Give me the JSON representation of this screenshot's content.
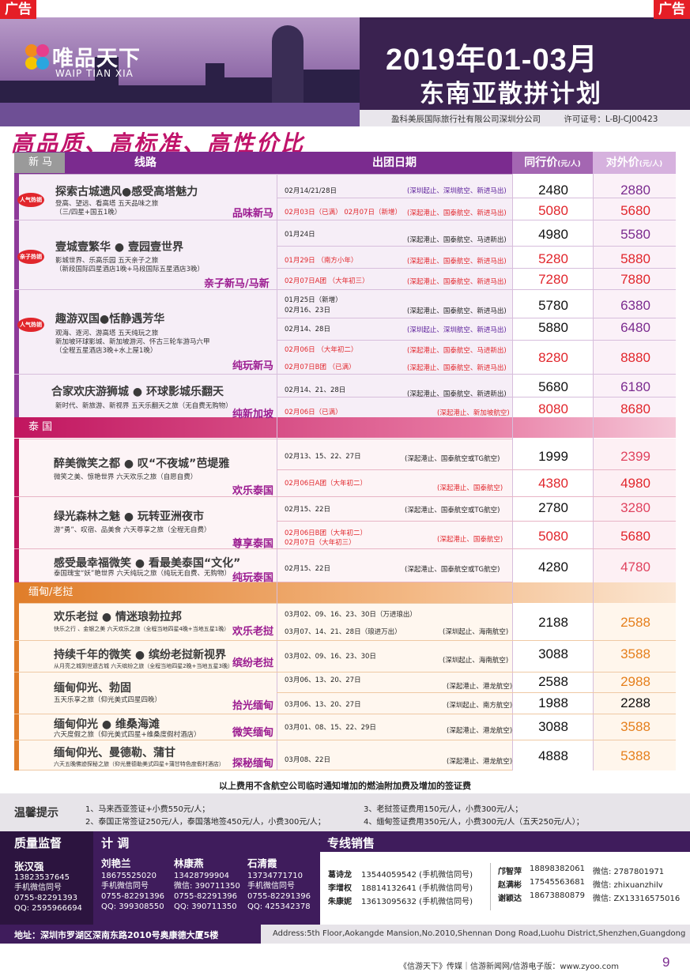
{
  "ad_label": "广告",
  "brand": {
    "cn": "唯品天下",
    "en": "WAIP TIAN XIA"
  },
  "header": {
    "title1": "2019年01-03月",
    "title2": "东南亚散拼计划",
    "company": "盈科美辰国际旅行社有限公司深圳分公司",
    "license": "许可证号：L-BJ-CJ00423"
  },
  "slogan": "高品质、高标准、高性价比",
  "table_header": {
    "route": "线路",
    "date": "出团日期",
    "peer": "同行价",
    "peer_unit": "(元/人)",
    "public": "对外价",
    "public_unit": "(元/人)"
  },
  "regions": {
    "sgmy": "新 马",
    "th": "泰 国",
    "mm": "缅甸/老挝"
  },
  "badges": {
    "hot": "人气热销",
    "family": "亲子热销"
  },
  "routes": [
    {
      "name": "探索古城遗风●感受高塔魅力",
      "desc": [
        "登高、望远、看高塔 五天品味之旅",
        "（三/四星+国五1晚）"
      ],
      "tag": "品味新马"
    },
    {
      "name": "壹城壹繁华 ● 壹园壹世界",
      "desc": [
        "影城世界、乐高乐园 五天亲子之旅",
        "（新段国际四星酒店1晚+马段国际五星酒店3晚）"
      ],
      "tag": "亲子新马/马新"
    },
    {
      "name": "趣游双国●恬静遇芳华",
      "desc": [
        "观海、逐河、游高塔 五天纯玩之旅",
        "新加坡环球影城、新加坡游河、怀古三轮车游马六甲",
        "（全程五星酒店3晚+水上屋1晚）"
      ],
      "tag": "纯玩新马"
    },
    {
      "name": "合家欢庆游狮城 ● 环球影城乐翻天",
      "desc": [
        "新时代、新旅游、新视界  五天乐翻天之旅（无自费无购物）"
      ],
      "tag": "纯新加坡"
    },
    {
      "name": "醉美微笑之都 ● 叹“不夜城”芭堤雅",
      "desc": [
        "微笑之美、惊艳世界 六天欢乐之旅（自愿自费）"
      ],
      "tag": "欢乐泰国"
    },
    {
      "name": "绿光森林之魅 ● 玩转亚洲夜市",
      "desc": [
        "游“勇”、叹宿、品美食 六天尊享之旅（全程无自费）"
      ],
      "tag": "尊享泰国"
    },
    {
      "name": "感受最幸福微笑 ● 看最美泰国“文化”",
      "desc": [
        "泰国瑰宝“妖”艳世界 六天纯玩之旅（纯玩无自费、无购物）"
      ],
      "tag": "纯玩泰国"
    },
    {
      "name": "欢乐老挝  ●  情迷琅勃拉邦",
      "desc": [
        "快乐之行 、金银之美 六天欢乐之旅（全程当地四星4晚+当地五星1晚）"
      ],
      "tag": "欢乐老挝"
    },
    {
      "name": "持续千年的微笑 ● 缤纷老挝新视界",
      "desc": [
        "从月亮之城到世遗古城 六天缤纷之旅（全程当地四星2晚+当地五星3晚）"
      ],
      "tag": "缤纷老挝"
    },
    {
      "name": "缅甸仰光、勃固",
      "desc": [
        "五天乐享之旅（仰光美式四星四晚）"
      ],
      "tag": "拾光缅甸"
    },
    {
      "name": "缅甸仰光 ● 维桑海滩",
      "desc": [
        "六天度假之旅（仰光美式四星+维桑度假村酒店）"
      ],
      "tag": "微笑缅甸"
    },
    {
      "name": "缅甸仰光、曼德勒、蒲甘",
      "desc": [
        "六天五晚佛迹探秘之旅（仰光曼德勒美式四星+蒲甘特色度假村酒店）"
      ],
      "tag": "探秘缅甸"
    }
  ],
  "departures": [
    {
      "dates": "02月14/21/28日",
      "note": "(深圳起止、深圳航空、新进马出)",
      "peer": "2480",
      "public": "2880"
    },
    {
      "dates": "02月03日（已满） 02月07日（新增）",
      "note": "(深起港止、国泰航空、新进马出)",
      "peer": "5080",
      "public": "5680"
    },
    {
      "dates": "01月24日",
      "note": "(深起港止、国泰航空、马进新出)",
      "peer": "4980",
      "public": "5580"
    },
    {
      "dates": "01月29日  （南方小年）",
      "note": "(深起港止、国泰航空、新进马出)",
      "peer": "5280",
      "public": "5880"
    },
    {
      "dates": "02月07日A团  （大年初三）",
      "note": "(深起港止、国泰航空、新进马出)",
      "peer": "7280",
      "public": "7880"
    },
    {
      "dates": "01月25日（新增）",
      "note": "",
      "peer": "",
      "public": ""
    },
    {
      "dates": "02月16、23日",
      "note": "(深起港止、国泰航空、新进马出)",
      "peer": "5780",
      "public": "6380"
    },
    {
      "dates": "02月14、28日",
      "note": "(深圳起止、深圳航空、新进马出)",
      "peer": "5880",
      "public": "6480"
    },
    {
      "dates": "02月06日    （大年初二）",
      "note": "(深起港止、国泰航空、马进新出)",
      "peer": "",
      "public": ""
    },
    {
      "dates": "02月07日B团  （已满）",
      "note": "(深起港止、国泰航空、新进马出)",
      "peer": "8280",
      "public": "8880"
    },
    {
      "dates": "02月14、21、28日",
      "note": "(深起港止、国泰航空、新进新出)",
      "peer": "5680",
      "public": "6180"
    },
    {
      "dates": "02月06日（已满）",
      "note": "(深起港止、新加坡航空)",
      "peer": "8080",
      "public": "8680"
    },
    {
      "dates": "02月13、15、22、27日",
      "note": "(深起港止、国泰航空或TG航空)",
      "peer": "1999",
      "public": "2399"
    },
    {
      "dates": "02月06日A团（大年初二）",
      "note": "(深起港止、国泰航空)",
      "peer": "4380",
      "public": "4980"
    },
    {
      "dates": "02月15、22日",
      "note": "(深起港止、国泰航空或TG航空)",
      "peer": "2780",
      "public": "3280"
    },
    {
      "dates": "02月06日B团（大年初二）",
      "note": "",
      "peer": "",
      "public": ""
    },
    {
      "dates": "02月07日（大年初三）",
      "note": "(深起港止、国泰航空)",
      "peer": "5080",
      "public": "5680"
    },
    {
      "dates": "02月15、22日",
      "note": "(深起港止、国泰航空或TG航空)",
      "peer": "4280",
      "public": "4780"
    },
    {
      "dates": "03月02、09、16、23、30日（万进琅出）",
      "note": "",
      "peer": "",
      "public": ""
    },
    {
      "dates": "03月07、14、21、28日（琅进万出）",
      "note": "(深圳起止、海南航空)",
      "peer": "2188",
      "public": "2588"
    },
    {
      "dates": "03月02、09、16、23、30日",
      "note": "(深圳起止、海南航空)",
      "peer": "3088",
      "public": "3588"
    },
    {
      "dates": "03月06、13、20、27日",
      "note": "(深起港止、港龙航空)",
      "peer": "2588",
      "public": "2988"
    },
    {
      "dates": "03月06、13、20、27日",
      "note": "(深圳起止、南方航空)",
      "peer": "1988",
      "public": "2288"
    },
    {
      "dates": "03月01、08、15、22、29日",
      "note": "(深起港止、港龙航空)",
      "peer": "3088",
      "public": "3588"
    },
    {
      "dates": "03月08、22日",
      "note": "(深起港止、港龙航空)",
      "peer": "4888",
      "public": "5388"
    }
  ],
  "footnote": "以上费用不含航空公司临时通知增加的燃油附加费及增加的签证费",
  "tips": {
    "title": "温馨提示",
    "items": [
      "1、马来西亚签证+小费550元/人；",
      "2、泰国正常签证250元/人，泰国落地签450元/人，小费300元/人；",
      "3、老挝签证费用150元/人，小费300元/人；",
      "4、缅甸签证费用350元/人，小费300元/人（五天250元/人）；"
    ]
  },
  "contacts": {
    "quality_title": "质量监督",
    "dispatch_title": "计  调",
    "sales_title": "专线销售",
    "quality": {
      "name": "张汉强",
      "lines": [
        "13823537645",
        "手机微信同号",
        "0755-82291393",
        "QQ: 2595966694"
      ]
    },
    "dispatch": [
      {
        "name": "刘艳兰",
        "lines": [
          "18675525020",
          "手机微信同号",
          "0755-82291396",
          "QQ: 399308550"
        ]
      },
      {
        "name": "林康燕",
        "lines": [
          "13428799904",
          "微信: 390711350",
          "0755-82291396",
          "QQ: 390711350"
        ]
      },
      {
        "name": "石清霞",
        "lines": [
          "13734771710",
          "手机微信同号",
          "0755-82291396",
          "QQ: 425342378"
        ]
      }
    ],
    "sales_left": [
      {
        "name": "葛诗龙",
        "info": "13544059542 (手机微信同号)"
      },
      {
        "name": "李增权",
        "info": "18814132641 (手机微信同号)"
      },
      {
        "name": "朱康妮",
        "info": "13613095632 (手机微信同号)"
      }
    ],
    "sales_right": [
      {
        "name": "邝智萍",
        "phone": "18898382061",
        "wx": "微信: 2787801971"
      },
      {
        "name": "赵满彬",
        "phone": "17545563681",
        "wx": "微信: zhixuanzhilv"
      },
      {
        "name": "谢颖达",
        "phone": "18673880879",
        "wx": "微信: ZX13316575016"
      }
    ]
  },
  "address": {
    "cn": "地址：深圳市罗湖区深南东路2010号奥康德大厦5楼",
    "en": "Address:5th Floor,Aokangde Mansion,No.2010,Shennan Dong Road,Luohu District,Shenzhen,Guangdong"
  },
  "footer": {
    "text": "《信游天下》传媒｜信游新闻网/信游电子版：www.zyoo.com",
    "page": "9"
  }
}
